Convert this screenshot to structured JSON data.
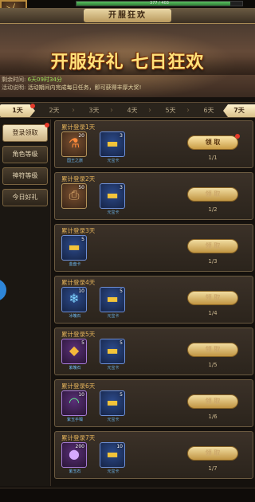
{
  "hud": {
    "hp_text": "377 / 403",
    "hp_fraction": 0.93
  },
  "window": {
    "title": "开服狂欢"
  },
  "banner": {
    "title": "开服好礼  七日狂欢",
    "remain_label": "剩余时间:",
    "remain_value": "6天09时34分",
    "desc_label": "活动说明:",
    "desc_value": "活动期间内完成每日任务，即可获得丰厚大奖!"
  },
  "tabs": [
    "1天",
    "2天",
    "3天",
    "4天",
    "5天",
    "6天",
    "7天"
  ],
  "side_menu": [
    "登录领取",
    "角色等级",
    "神符等级",
    "今日好礼"
  ],
  "rows": [
    {
      "title": "累计登录1天",
      "items": [
        {
          "name": "国王之旅",
          "qty": "20",
          "icon": "potion-icon",
          "rarity": "orange"
        },
        {
          "name": "元宝卡",
          "qty": "3",
          "icon": "gold-bar-icon",
          "rarity": "blue"
        }
      ],
      "button": "领  取",
      "progress": "1/1",
      "claimable": true
    },
    {
      "title": "累计登录2天",
      "items": [
        {
          "name": "",
          "qty": "50",
          "icon": "scroll-icon",
          "rarity": "orange"
        },
        {
          "name": "元宝卡",
          "qty": "3",
          "icon": "gold-bar-icon",
          "rarity": "blue"
        }
      ],
      "button": "领  取",
      "progress": "1/2",
      "claimable": false
    },
    {
      "title": "累计登录3天",
      "items": [
        {
          "name": "金盘卡",
          "qty": "5",
          "icon": "gold-bar-icon",
          "rarity": "blue"
        }
      ],
      "button": "领  取",
      "progress": "1/3",
      "claimable": false
    },
    {
      "title": "累计登录4天",
      "items": [
        {
          "name": "冰魄石",
          "qty": "10",
          "icon": "ice-orb-icon",
          "rarity": "blue"
        },
        {
          "name": "元宝卡",
          "qty": "5",
          "icon": "gold-bar-icon",
          "rarity": "blue"
        }
      ],
      "button": "领  取",
      "progress": "1/4",
      "claimable": false
    },
    {
      "title": "累计登录5天",
      "items": [
        {
          "name": "紫魄石",
          "qty": "5",
          "icon": "gold-gem-icon",
          "rarity": "purple"
        },
        {
          "name": "元宝卡",
          "qty": "5",
          "icon": "gold-bar-icon",
          "rarity": "blue"
        }
      ],
      "button": "领  取",
      "progress": "1/5",
      "claimable": false
    },
    {
      "title": "累计登录6天",
      "items": [
        {
          "name": "紫玉手镯",
          "qty": "10",
          "icon": "bracelet-icon",
          "rarity": "purple"
        },
        {
          "name": "元宝卡",
          "qty": "5",
          "icon": "gold-bar-icon",
          "rarity": "blue"
        }
      ],
      "button": "领  取",
      "progress": "1/6",
      "claimable": false
    },
    {
      "title": "累计登录7天",
      "items": [
        {
          "name": "紫玉石",
          "qty": "200",
          "icon": "purple-stone-icon",
          "rarity": "purple"
        },
        {
          "name": "元宝卡",
          "qty": "10",
          "icon": "gold-bar-icon",
          "rarity": "blue"
        }
      ],
      "button": "领  取",
      "progress": "1/7",
      "claimable": false
    }
  ]
}
